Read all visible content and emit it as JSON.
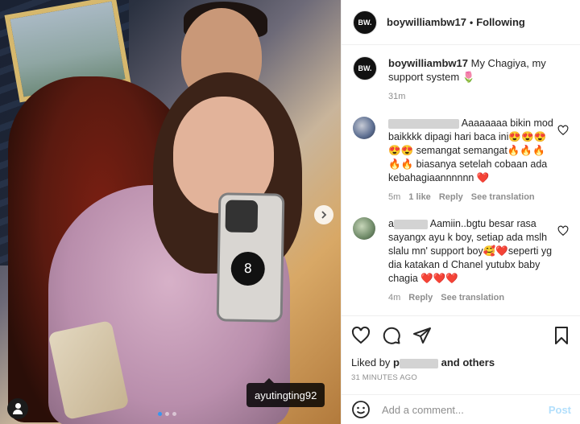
{
  "post": {
    "photo_tag": "ayutingting92",
    "carousel_dots": 3,
    "carousel_active": 1
  },
  "header": {
    "avatar_text": "BW.",
    "username": "boywilliambw17",
    "separator": "•",
    "follow_status": "Following"
  },
  "caption": {
    "avatar_text": "BW.",
    "username": "boywilliambw17",
    "text": "My Chagiya, my support system 🌷",
    "time": "31m"
  },
  "comments": [
    {
      "text": "Aaaaaaaa bikin mod baikkkk dipagi hari baca ini😍😍😍😍😍 semangat semangat🔥🔥🔥🔥🔥 biasanya setelah cobaan ada kebahagiaannnnnn ❤️",
      "time": "5m",
      "likes": "1 like",
      "reply": "Reply",
      "translate": "See translation"
    },
    {
      "username_prefix": "a",
      "text": "Aamiin..bgtu besar rasa sayangx ayu k boy, setiap ada mslh slalu mn' support boy🥰❤️seperti yg dia katakan d Chanel yutubx baby chagia ❤️❤️❤️",
      "time": "4m",
      "reply": "Reply",
      "translate": "See translation"
    }
  ],
  "likes": {
    "prefix": "Liked by",
    "user_initial": "p",
    "suffix": "and others"
  },
  "posted_ago": "31 MINUTES AGO",
  "composer": {
    "placeholder": "Add a comment...",
    "post_label": "Post"
  },
  "colors": {
    "link_blue": "#3897f0",
    "post_disabled": "#b2dffc",
    "meta_gray": "#8e8e8e"
  }
}
